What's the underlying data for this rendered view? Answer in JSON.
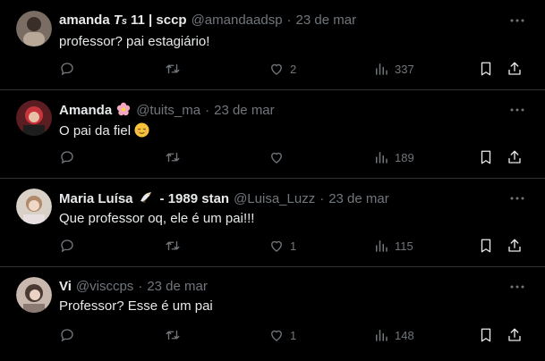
{
  "tweets": [
    {
      "name": "amanda",
      "name_extra": "11 | sccp",
      "handle": "@amandaadsp",
      "time": "23 de mar",
      "text": "professor? pai estagiário!",
      "reply_count": "",
      "likes": "2",
      "views": "337"
    },
    {
      "name": "Amanda",
      "name_extra": "",
      "handle": "@tuits_ma",
      "time": "23 de mar",
      "text": "O pai da fiel",
      "reply_count": "",
      "likes": "",
      "views": "189"
    },
    {
      "name": "Maria Luísa",
      "name_extra": "- 1989 stan",
      "handle": "@Luisa_Luzz",
      "time": "23 de mar",
      "text": "Que professor oq, ele é um pai!!!",
      "reply_count": "",
      "likes": "1",
      "views": "115"
    },
    {
      "name": "Vi",
      "name_extra": "",
      "handle": "@visccps",
      "time": "23 de mar",
      "text": "Professor? Esse é um pai",
      "reply_count": "",
      "likes": "1",
      "views": "148"
    }
  ],
  "separator": "·",
  "colors": {
    "text": "#e7e9ea",
    "muted": "#71767b",
    "divider": "#2f3336",
    "background": "#000000"
  }
}
